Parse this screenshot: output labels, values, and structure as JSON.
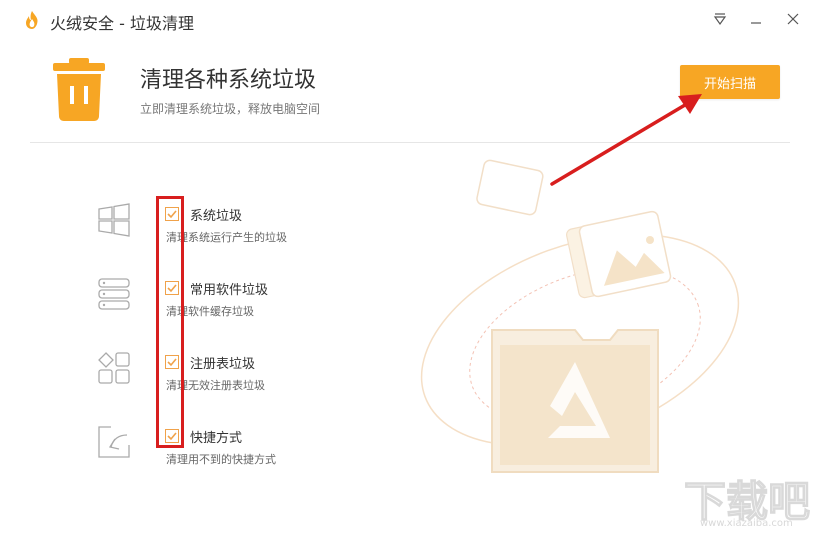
{
  "window": {
    "title": "火绒安全 - 垃圾清理"
  },
  "header": {
    "title": "清理各种系统垃圾",
    "subtitle": "立即清理系统垃圾，释放电脑空间",
    "scan_button": "开始扫描"
  },
  "items": [
    {
      "title": "系统垃圾",
      "desc": "清理系统运行产生的垃圾",
      "checked": true,
      "icon": "windows-icon"
    },
    {
      "title": "常用软件垃圾",
      "desc": "清理软件缓存垃圾",
      "checked": true,
      "icon": "database-icon"
    },
    {
      "title": "注册表垃圾",
      "desc": "清理无效注册表垃圾",
      "checked": true,
      "icon": "registry-icon"
    },
    {
      "title": "快捷方式",
      "desc": "清理用不到的快捷方式",
      "checked": true,
      "icon": "shortcut-icon"
    }
  ],
  "colors": {
    "accent": "#f7a624",
    "annotation_red": "#d81e1e"
  },
  "watermark": {
    "text": "下载吧",
    "sub": "www.xiazaiba.com"
  }
}
